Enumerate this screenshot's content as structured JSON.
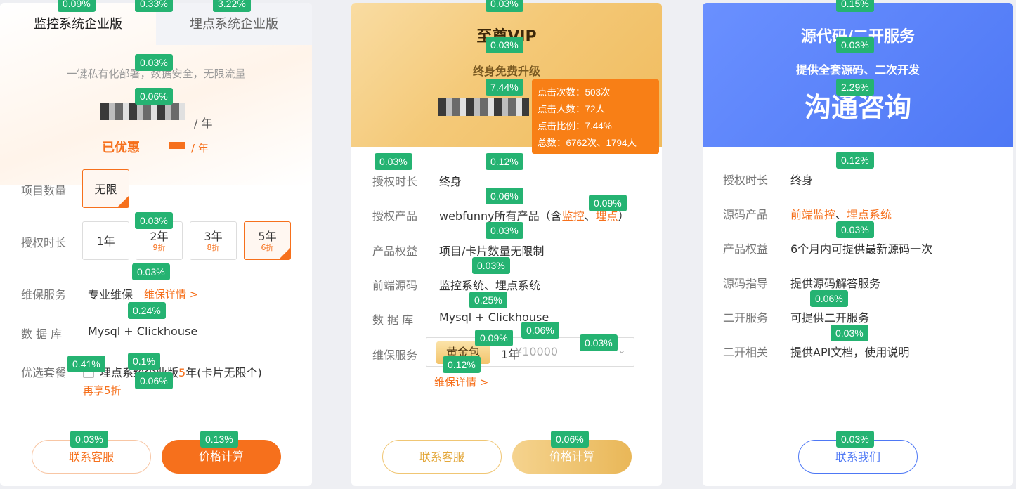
{
  "card1": {
    "tab_active": "监控系统企业版",
    "tab_inactive": "埋点系统企业版",
    "subtitle": "一键私有化部署，数据安全，无限流量",
    "price_unit": "/ 年",
    "discount_label": "已优惠",
    "discount_unit": "/ 年",
    "rows": {
      "project_count_label": "项目数量",
      "project_count_option": "无限",
      "duration_label": "授权时长",
      "duration_options": [
        {
          "label": "1年",
          "sub": ""
        },
        {
          "label": "2年",
          "sub": "9折"
        },
        {
          "label": "3年",
          "sub": "8折"
        },
        {
          "label": "5年",
          "sub": "6折"
        }
      ],
      "maintenance_label": "维保服务",
      "maintenance_value": "专业维保",
      "maintenance_link": "维保详情 >",
      "database_label": "数 据 库",
      "database_value": "Mysql + Clickhouse",
      "package_label": "优选套餐",
      "package_value_prefix": "埋点系统企业版",
      "package_value_highlight": "5",
      "package_value_suffix": "年(卡片无限个)",
      "package_extra": "再享5折"
    },
    "btn_contact": "联系客服",
    "btn_calc": "价格计算"
  },
  "card2": {
    "title": "至尊VIP",
    "subtitle": "终身免费升级",
    "rows": {
      "duration_label": "授权时长",
      "duration_value": "终身",
      "product_label": "授权产品",
      "product_value_prefix": "webfunny所有产品（含",
      "product_link1": "监控",
      "product_sep": "、",
      "product_link2": "埋点",
      "product_suffix": "）",
      "benefit_label": "产品权益",
      "benefit_value": "项目/卡片数量无限制",
      "source_label": "前端源码",
      "source_value": "监控系统、埋点系统",
      "database_label": "数 据 库",
      "database_value": "Mysql + Clickhouse",
      "maintenance_label": "维保服务",
      "maintenance_pill": "黄金包",
      "maintenance_year": "1年",
      "maintenance_price": "¥10000",
      "maintenance_link": "维保详情 >"
    },
    "btn_contact": "联系客服",
    "btn_calc": "价格计算"
  },
  "card3": {
    "title": "源代码/二开服务",
    "subtitle": "提供全套源码、二次开发",
    "headline": "沟通咨询",
    "rows": {
      "duration_label": "授权时长",
      "duration_value": "终身",
      "source_label": "源码产品",
      "source_link1": "前端监控",
      "source_sep": "、",
      "source_link2": "埋点系统",
      "benefit_label": "产品权益",
      "benefit_value": "6个月内可提供最新源码一次",
      "guide_label": "源码指导",
      "guide_value": "提供源码解答服务",
      "dev_label": "二开服务",
      "dev_value": "可提供二开服务",
      "related_label": "二开相关",
      "related_value": "提供API文档，使用说明"
    },
    "btn_contact": "联系我们"
  },
  "tooltip": {
    "clicks": "点击次数：503次",
    "users": "点击人数：72人",
    "ratio": "点击比例：7.44%",
    "total": "总数：6762次、1794人"
  },
  "badges": [
    "0.09%",
    "0.33%",
    "3.22%",
    "0.03%",
    "0.06%",
    "0.03%",
    "0.03%",
    "0.24%",
    "0.41%",
    "0.1%",
    "0.06%",
    "0.03%",
    "0.13%",
    "0.03%",
    "0.03%",
    "7.44%",
    "0.03%",
    "0.12%",
    "0.06%",
    "0.09%",
    "0.03%",
    "0.03%",
    "0.25%",
    "0.09%",
    "0.06%",
    "0.03%",
    "0.12%",
    "0.06%",
    "0.15%",
    "0.03%",
    "2.29%",
    "0.12%",
    "0.03%",
    "0.06%",
    "0.03%",
    "0.03%"
  ],
  "colors": {
    "accent_orange": "#f6701c",
    "badge_green": "#25b372",
    "gold": "#f0bb5d",
    "blue": "#4e78f5"
  }
}
